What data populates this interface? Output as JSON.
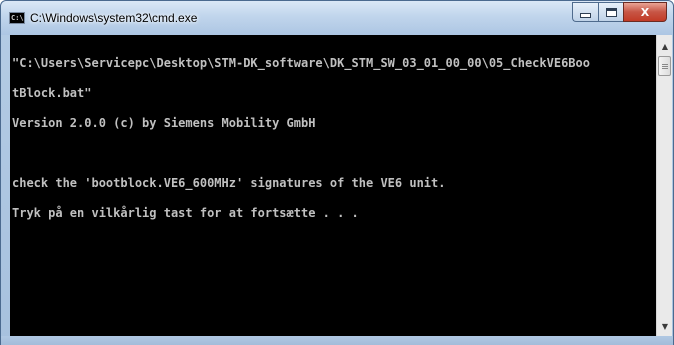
{
  "window": {
    "title": "C:\\Windows\\system32\\cmd.exe",
    "icon_label": "C:\\",
    "buttons": {
      "minimize": "minimize",
      "maximize": "maximize",
      "close": "X"
    }
  },
  "console": {
    "background": "#000000",
    "foreground": "#c0c0c0",
    "lines": [
      "\"C:\\Users\\Servicepc\\Desktop\\STM-DK_software\\DK_STM_SW_03_01_00_00\\05_CheckVE6Boo",
      "tBlock.bat\"",
      "Version 2.0.0 (c) by Siemens Mobility GmbH",
      "",
      "check the 'bootblock.VE6_600MHz' signatures of the VE6 unit.",
      "Tryk på en vilkårlig tast for at fortsætte . . ."
    ]
  },
  "colors": {
    "close_button": "#c23a26",
    "titlebar": "#c0d5ec"
  }
}
